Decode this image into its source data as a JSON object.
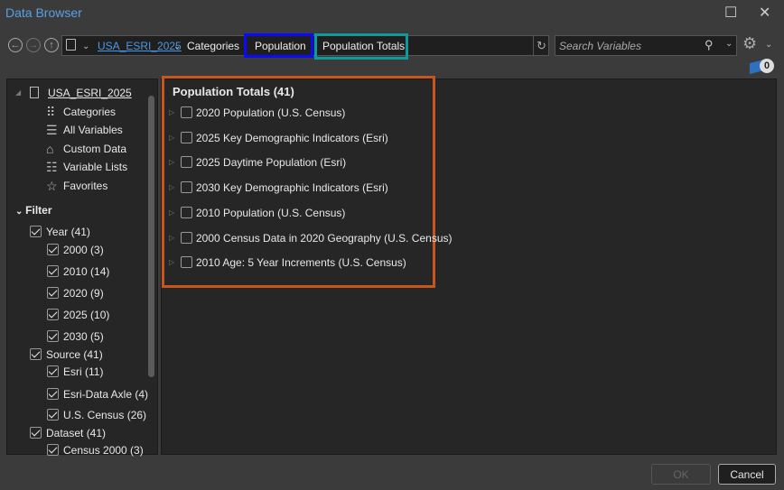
{
  "window": {
    "title": "Data Browser",
    "maximize": "☐",
    "close": "✕"
  },
  "breadcrumb": {
    "root": "USA_ESRI_2025",
    "items": [
      "Categories",
      "Population",
      "Population Totals"
    ]
  },
  "search": {
    "placeholder": "Search Variables"
  },
  "selection_count": "0",
  "tree": {
    "root": "USA_ESRI_2025",
    "items": [
      "Categories",
      "All Variables",
      "Custom Data",
      "Variable Lists",
      "Favorites"
    ]
  },
  "filter": {
    "label": "Filter",
    "groups": [
      {
        "label": "Year (41)",
        "items": [
          "2000 (3)",
          "2010 (14)",
          "2020 (9)",
          "2025 (10)",
          "2030 (5)"
        ]
      },
      {
        "label": "Source (41)",
        "items": [
          "Esri (11)",
          "Esri-Data Axle (4)",
          "U.S. Census (26)"
        ]
      },
      {
        "label": "Dataset (41)",
        "items": [
          "Census 2000 (3)"
        ]
      }
    ]
  },
  "main": {
    "heading": "Population Totals (41)",
    "items": [
      "2020 Population (U.S. Census)",
      "2025 Key Demographic Indicators (Esri)",
      "2025 Daytime Population (Esri)",
      "2030 Key Demographic Indicators (Esri)",
      "2010 Population (U.S. Census)",
      "2000 Census Data in 2020 Geography (U.S. Census)",
      "2010 Age: 5 Year Increments (U.S. Census)"
    ]
  },
  "footer": {
    "ok": "OK",
    "cancel": "Cancel"
  },
  "colors": {
    "highlight_population": "#0a0aff",
    "highlight_totals": "#0e9a9a",
    "highlight_panel": "#c8561a",
    "link": "#4a9ae8"
  }
}
